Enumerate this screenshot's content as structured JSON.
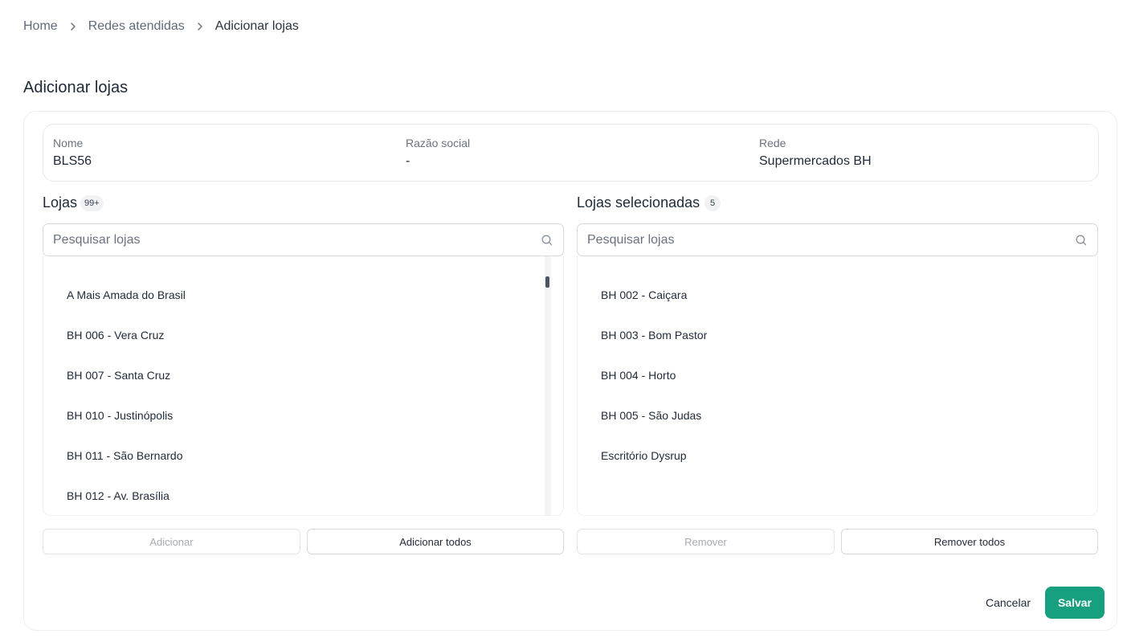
{
  "breadcrumb": {
    "items": [
      "Home",
      "Redes atendidas",
      "Adicionar lojas"
    ]
  },
  "page": {
    "title": "Adicionar lojas"
  },
  "info": {
    "nome_label": "Nome",
    "nome_value": "BLS56",
    "razao_label": "Razão social",
    "razao_value": "-",
    "rede_label": "Rede",
    "rede_value": "Supermercados BH"
  },
  "left_panel": {
    "title": "Lojas",
    "count": "99+",
    "search_placeholder": "Pesquisar lojas",
    "items": [
      "A Mais Amada do Brasil",
      "BH 006 - Vera Cruz",
      "BH 007 - Santa Cruz",
      "BH 010 - Justinópolis",
      "BH 011 - São Bernardo",
      "BH 012 - Av. Brasília"
    ],
    "add_label": "Adicionar",
    "add_all_label": "Adicionar todos"
  },
  "right_panel": {
    "title": "Lojas selecionadas",
    "count": "5",
    "search_placeholder": "Pesquisar lojas",
    "items": [
      "BH 002 - Caiçara",
      "BH 003 - Bom Pastor",
      "BH 004 - Horto",
      "BH 005 - São Judas",
      "Escritório Dysrup"
    ],
    "remove_label": "Remover",
    "remove_all_label": "Remover todos"
  },
  "footer": {
    "cancel_label": "Cancelar",
    "save_label": "Salvar"
  },
  "colors": {
    "primary": "#17a07f",
    "text": "#1f2937",
    "muted": "#6b7280"
  }
}
